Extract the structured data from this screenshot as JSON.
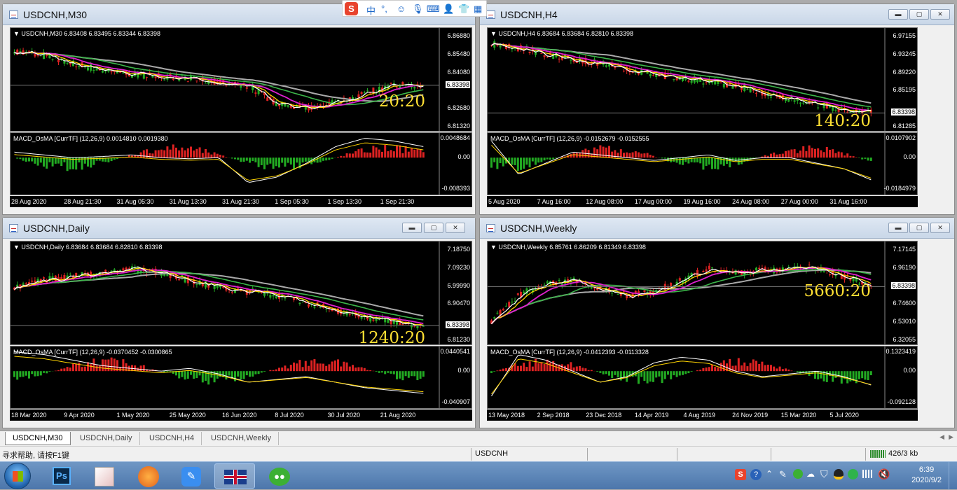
{
  "windows": [
    {
      "id": "m30",
      "title": "USDCNH,M30",
      "info": "USDCNH,M30  6.83408 6.83495 6.83344 6.83398",
      "prices": [
        "6.86880",
        "6.85480",
        "6.84080",
        "6.83398",
        "6.82680",
        "6.81320"
      ],
      "timer": "20:20",
      "macd_info": "MACD_OsMA [CurrTF] (12,26,9) 0.0014810 0.0019380",
      "macd_scale": [
        "0.0048684",
        "0.00",
        "-0.008393"
      ],
      "xlabels": [
        "28 Aug 2020",
        "28 Aug 21:30",
        "31 Aug 05:30",
        "31 Aug 13:30",
        "31 Aug 21:30",
        "1 Sep 05:30",
        "1 Sep 13:30",
        "1 Sep 21:30"
      ]
    },
    {
      "id": "h4",
      "title": "USDCNH,H4",
      "info": "USDCNH,H4  6.83684 6.83684 6.82810 6.83398",
      "prices": [
        "6.97155",
        "6.93245",
        "6.89220",
        "6.85195",
        "6.83398",
        "6.81285"
      ],
      "timer": "140:20",
      "macd_info": "MACD_OsMA [CurrTF] (12,26,9) -0.0152679 -0.0152555",
      "macd_scale": [
        "0.0107902",
        "0.00",
        "-0.0184979"
      ],
      "xlabels": [
        "5 Aug 2020",
        "7 Aug 16:00",
        "12 Aug 08:00",
        "17 Aug 00:00",
        "19 Aug 16:00",
        "24 Aug 08:00",
        "27 Aug 00:00",
        "31 Aug 16:00"
      ]
    },
    {
      "id": "daily",
      "title": "USDCNH,Daily",
      "info": "USDCNH,Daily  6.83684 6.83684 6.82810 6.83398",
      "prices": [
        "7.18750",
        "7.09230",
        "6.99990",
        "6.90470",
        "6.83398",
        "6.81230"
      ],
      "timer": "1240:20",
      "macd_info": "MACD_OsMA [CurrTF] (12,26,9) -0.0370452 -0.0300865",
      "macd_scale": [
        "0.0440541",
        "0.00",
        "-0.040907"
      ],
      "xlabels": [
        "18 Mar 2020",
        "9 Apr 2020",
        "1 May 2020",
        "25 May 2020",
        "16 Jun 2020",
        "8 Jul 2020",
        "30 Jul 2020",
        "21 Aug 2020"
      ]
    },
    {
      "id": "weekly",
      "title": "USDCNH,Weekly",
      "info": "USDCNH,Weekly  6.85761 6.86209 6.81349 6.83398",
      "prices": [
        "7.17145",
        "6.96190",
        "6.83398",
        "6.74600",
        "6.53010",
        "6.32055"
      ],
      "timer": "5660:20",
      "macd_info": "MACD_OsMA [CurrTF] (12,26,9) -0.0412393 -0.0113328",
      "macd_scale": [
        "0.1323419",
        "0.00",
        "-0.092128"
      ],
      "xlabels": [
        "13 May 2018",
        "2 Sep 2018",
        "23 Dec 2018",
        "14 Apr 2019",
        "4 Aug 2019",
        "24 Nov 2019",
        "15 Mar 2020",
        "5 Jul 2020"
      ]
    }
  ],
  "tabs": [
    "USDCNH,M30",
    "USDCNH,Daily",
    "USDCNH,H4",
    "USDCNH,Weekly"
  ],
  "status": {
    "help": "寻求帮助, 请按F1键",
    "symbol": "USDCNH",
    "traffic": "426/3 kb"
  },
  "clock": {
    "time": "6:39",
    "date": "2020/9/2"
  },
  "ime": {
    "lang": "中",
    "punct": "°,"
  },
  "colors": {
    "bull": "#d22",
    "bear": "#2a2",
    "ma_fast": "#fff",
    "ma_yellow": "#ffd400",
    "ma_magenta": "#e020d0",
    "ma_green": "#3cb54a",
    "ma_grey": "#aaa",
    "timer": "#ffe033"
  }
}
